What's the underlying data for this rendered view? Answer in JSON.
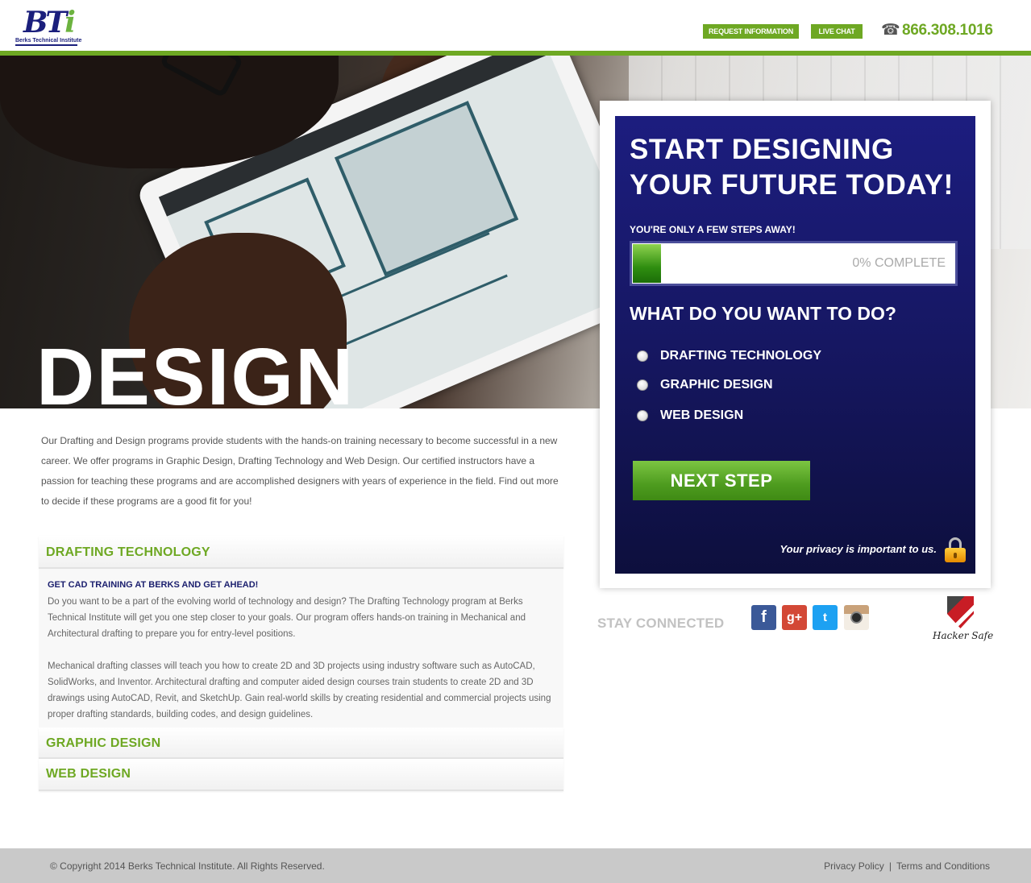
{
  "header": {
    "logo_mark": "BT",
    "logo_mark_i": "i",
    "logo_text": "Berks Technical Institute",
    "request_info": "REQUEST INFORMATION",
    "live_chat": "LIVE CHAT",
    "phone_icon": "☎",
    "phone": "866.308.1016",
    "accent_color": "#6ea823"
  },
  "hero": {
    "title": "DESIGN",
    "image": "student-drawing-on-tablet"
  },
  "intro": "Our Drafting and Design programs provide students with the hands-on training necessary to become successful in a new career. We offer programs in Graphic Design, Drafting Technology and Web Design. Our certified instructors have a passion for teaching these programs and are accomplished designers with years of experience in the field. Find out more to decide if these programs are a good fit for you!",
  "accordion": {
    "items": [
      {
        "title": "DRAFTING TECHNOLOGY",
        "expanded": true
      },
      {
        "title": "GRAPHIC DESIGN",
        "expanded": false
      },
      {
        "title": "WEB DESIGN",
        "expanded": false
      }
    ],
    "body": {
      "subtitle": "GET CAD TRAINING AT BERKS AND GET AHEAD!",
      "p1": "Do you want to be a part of the evolving world of technology and design? The Drafting Technology program at Berks Technical Institute will get you one step closer to your goals. Our program offers hands-on training in Mechanical and Architectural drafting to prepare you for entry-level positions.",
      "p2": "Mechanical drafting classes will teach you how to create 2D and 3D projects using industry software such as AutoCAD, SolidWorks, and Inventor. Architectural drafting and computer aided design courses train students to create 2D and 3D drawings using AutoCAD, Revit, and SketchUp. Gain real-world skills by creating residential and commercial projects using proper drafting standards, building codes, and design guidelines."
    }
  },
  "form": {
    "headline": "START DESIGNING YOUR FUTURE TODAY!",
    "steps_label": "YOU'RE ONLY A FEW STEPS AWAY!",
    "progress_text": "0% COMPLETE",
    "progress_value": 0,
    "question": "WHAT DO YOU WANT TO DO?",
    "options": [
      "DRAFTING TECHNOLOGY",
      "GRAPHIC DESIGN",
      "WEB DESIGN"
    ],
    "next_button": "NEXT STEP",
    "privacy": "Your privacy is important to us.",
    "panel_color": "#1c1d7f"
  },
  "social": {
    "label": "STAY CONNECTED",
    "icons": [
      "facebook-icon",
      "google-plus-icon",
      "twitter-icon",
      "instagram-icon"
    ],
    "fb": "f",
    "gp": "g+",
    "tw": "t",
    "badge": "Hacker Safe"
  },
  "footer": {
    "copyright": "© Copyright 2014  Berks Technical Institute. All Rights Reserved.",
    "privacy_policy": "Privacy Policy",
    "separator": "|",
    "terms": "Terms and Conditions"
  }
}
